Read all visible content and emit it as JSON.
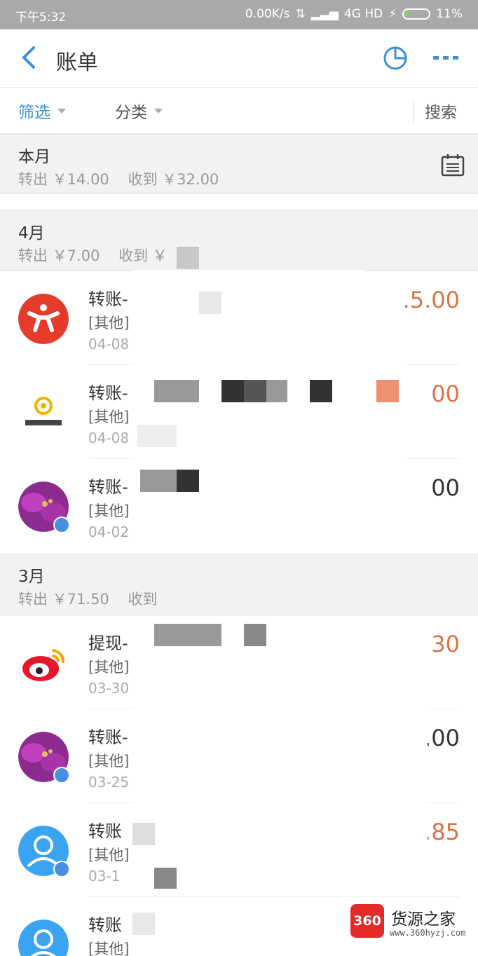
{
  "status_bar": {
    "time": "下午5:32",
    "net_speed": "0.00K/s",
    "network": "4G HD",
    "battery": "11%"
  },
  "nav": {
    "title": "账单"
  },
  "filters": {
    "filter_label": "筛选",
    "category_label": "分类",
    "search_label": "搜索"
  },
  "colors": {
    "accent": "#3d8fd6",
    "amount_orange": "#d9734a"
  },
  "months": [
    {
      "title": "本月",
      "summary": "转出 ￥14.00    收到 ￥32.00"
    },
    {
      "title": "4月",
      "summary": "转出 ￥7.00    收到 ￥"
    },
    {
      "title": "3月",
      "summary": "转出 ￥71.50    收到"
    }
  ],
  "transactions": [
    {
      "name": "转账-",
      "category": "[其他]",
      "date": "04-08",
      "amount": ".5.00",
      "avatar": "red-running-person-icon"
    },
    {
      "name": "转账-",
      "category": "[其他]",
      "date": "04-08",
      "amount": "00",
      "avatar": "huishoubao-logo"
    },
    {
      "name": "转账-",
      "category": "[其他]",
      "date": "04-02",
      "amount": "00",
      "avatar": "purple-flower-photo"
    },
    {
      "name": "提现-",
      "category": "[其他]",
      "date": "03-30",
      "amount": "30",
      "avatar": "weibo-icon"
    },
    {
      "name": "转账-",
      "category": "[其他]",
      "date": "03-25",
      "amount": ".00",
      "avatar": "purple-flower-photo"
    },
    {
      "name": "转账",
      "category": "[其他]",
      "date": "03-1",
      "amount": ".85",
      "avatar": "default-user-icon"
    },
    {
      "name": "转账",
      "category": "[其他]",
      "date": "",
      "amount": "",
      "avatar": "default-user-icon"
    }
  ],
  "watermark": {
    "logo": "360",
    "brand": "货源之家",
    "url": "www.360hyzj.com"
  }
}
